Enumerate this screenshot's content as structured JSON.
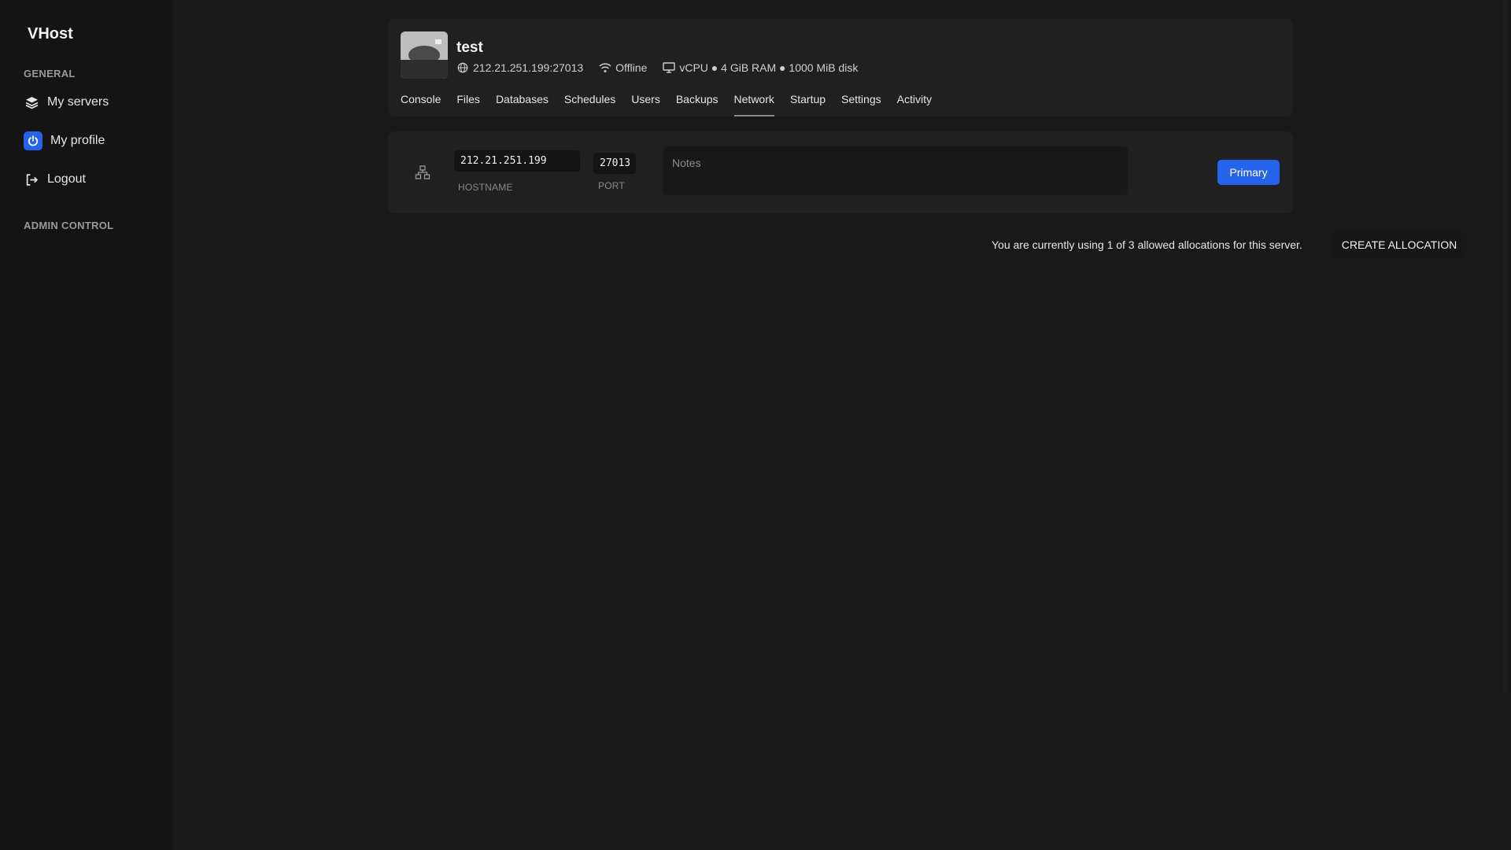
{
  "app": {
    "brand": "VHost"
  },
  "sidebar": {
    "general_label": "GENERAL",
    "items": [
      {
        "label": "My servers",
        "icon": "layers-icon"
      },
      {
        "label": "My profile",
        "icon": "power-icon"
      },
      {
        "label": "Logout",
        "icon": "logout-icon"
      }
    ],
    "admin_label": "ADMIN CONTROL"
  },
  "server": {
    "name": "test",
    "address": "212.21.251.199:27013",
    "status": "Offline",
    "resources": "vCPU ● 4 GiB RAM ● 1000 MiB disk"
  },
  "tabs": [
    {
      "label": "Console"
    },
    {
      "label": "Files"
    },
    {
      "label": "Databases"
    },
    {
      "label": "Schedules"
    },
    {
      "label": "Users"
    },
    {
      "label": "Backups"
    },
    {
      "label": "Network",
      "active": true
    },
    {
      "label": "Startup"
    },
    {
      "label": "Settings"
    },
    {
      "label": "Activity"
    }
  ],
  "allocation": {
    "hostname": "212.21.251.199",
    "hostname_label": "HOSTNAME",
    "port": "27013",
    "port_label": "PORT",
    "notes_placeholder": "Notes",
    "primary_label": "Primary"
  },
  "footer": {
    "usage_text": "You are currently using 1 of 3 allowed allocations for this server.",
    "create_label": "CREATE ALLOCATION"
  },
  "colors": {
    "accent": "#2563eb",
    "background": "#191919",
    "card": "#202020"
  }
}
